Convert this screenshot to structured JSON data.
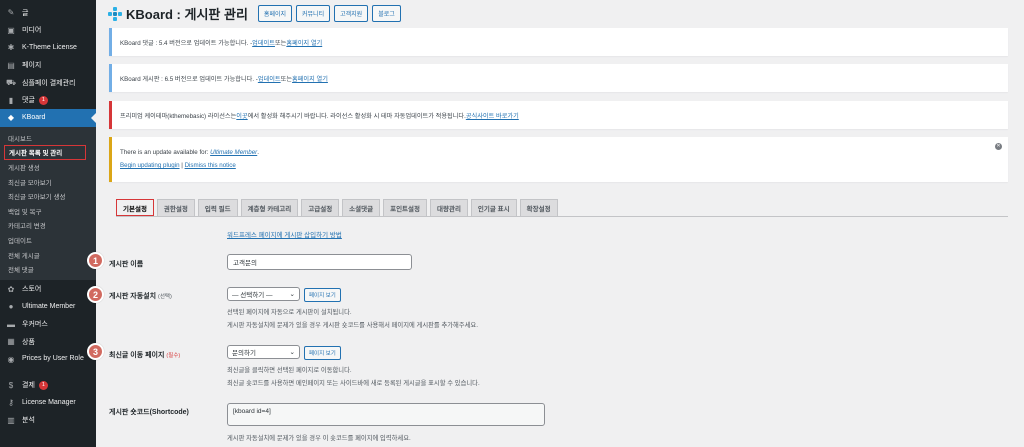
{
  "sidebar": {
    "items": [
      {
        "label": "글",
        "icon": "pin-icon"
      },
      {
        "label": "미디어",
        "icon": "media-icon"
      },
      {
        "label": "K-Theme License",
        "icon": "k-icon"
      },
      {
        "label": "페이지",
        "icon": "page-icon"
      },
      {
        "label": "심플페이 결제관리",
        "icon": "cart-icon"
      },
      {
        "label": "댓글",
        "icon": "comment-icon",
        "badge": "1"
      },
      {
        "label": "KBoard",
        "icon": "kboard-icon"
      }
    ],
    "submenu": [
      "대시보드",
      "게시판 목록 및 관리",
      "게시판 생성",
      "최신글 모아보기",
      "최신글 모아보기 생성",
      "백업 및 복구",
      "카테고리 변경",
      "업데이트",
      "전체 게시글",
      "전체 댓글"
    ],
    "items_after": [
      {
        "label": "스토어",
        "icon": "store-icon"
      },
      {
        "label": "Ultimate Member",
        "icon": "user-icon"
      },
      {
        "label": "우커머스",
        "icon": "woo-icon"
      },
      {
        "label": "상품",
        "icon": "product-icon"
      },
      {
        "label": "Prices by User Role",
        "icon": "prices-icon"
      },
      {
        "label": "결제",
        "icon": "payment-icon",
        "badge": "1"
      },
      {
        "label": "License Manager",
        "icon": "key-icon"
      },
      {
        "label": "분석",
        "icon": "chart-icon"
      }
    ]
  },
  "header": {
    "title": "KBoard : 게시판 관리",
    "buttons": [
      "홈페이지",
      "커뮤니티",
      "고객지원",
      "블로그"
    ]
  },
  "notices": {
    "n1": {
      "text": "KBoard 댓글 : 5.4 버전으로 업데이트 가능합니다. - ",
      "link1": "업데이트",
      "mid": " 또는 ",
      "link2": "홈페이지 열기"
    },
    "n2": {
      "text": "KBoard 게시판 : 6.5 버전으로 업데이트 가능합니다. - ",
      "link1": "업데이트",
      "mid": " 또는 ",
      "link2": "홈페이지 열기"
    },
    "n3": {
      "text": "프리미엄 케이테마(kthemebasic) 라이선스는 ",
      "link1": "이곳",
      "mid": " 에서 활성화 해주시기 바랍니다. 라이선스 활성화 시 테마 자동업데이트가 적용됩니다. ",
      "link2": "공식사이트 바로가기"
    },
    "n4": {
      "text": "There is an update available for: ",
      "plugin": "Ultimate Member",
      "dot": ".",
      "link1": "Begin updating plugin",
      "sep": " | ",
      "link2": "Dismiss this notice"
    }
  },
  "tabs": [
    "기본설정",
    "권한설정",
    "입력 필드",
    "계층형 카테고리",
    "고급설정",
    "소셜댓글",
    "포인트설정",
    "대량관리",
    "인기글 표시",
    "확장설정"
  ],
  "form": {
    "top_link": "워드프레스 페이지에 게시판 삽입하기 방법",
    "name_label": "게시판 이름",
    "name_value": "고객문의",
    "auto_label": "게시판 자동설치",
    "auto_note": "(선택)",
    "auto_select": "— 선택하기 —",
    "view_page": "페이지 보기",
    "auto_desc1": "선택된 페이지에 자동으로 게시판이 설치됩니다.",
    "auto_desc2": "게시판 자동설치에 문제가 있을 경우 게시판 숏코드를 사용해서 페이지에 게시판를 추가해주세요.",
    "latest_label": "최신글 이동 페이지",
    "latest_req": "(필수)",
    "latest_select": "문의하기",
    "latest_desc1": "최신글을 클릭하면 선택된 페이지로 이동합니다.",
    "latest_desc2": "최신글 숏코드를 사용하면 메인페이지 또는 사이드바에 새로 등록된 게시글을 표시할 수 있습니다.",
    "shortcode_label": "게시판 숏코드(Shortcode)",
    "shortcode_value": "[kboard id=4]",
    "shortcode_desc": "게시판 자동설치에 문제가 있을 경우 이 숏코드를 페이지에 입력하세요."
  },
  "markers": [
    "1",
    "2",
    "3"
  ]
}
